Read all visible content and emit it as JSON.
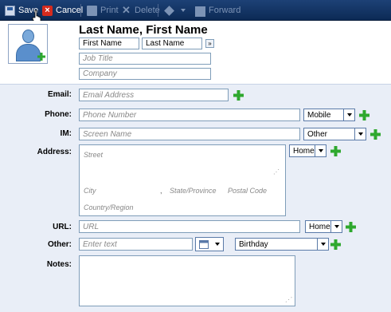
{
  "toolbar": {
    "save": "Save",
    "cancel": "Cancel",
    "print": "Print",
    "delete": "Delete",
    "forward": "Forward"
  },
  "header": {
    "display_name": "Last Name, First Name",
    "first_name": "First Name",
    "last_name": "Last Name",
    "more_name_btn": "»",
    "job_title_placeholder": "Job Title",
    "company_placeholder": "Company"
  },
  "form": {
    "email": {
      "label": "Email:",
      "placeholder": "Email Address"
    },
    "phone": {
      "label": "Phone:",
      "placeholder": "Phone Number",
      "type": "Mobile"
    },
    "im": {
      "label": "IM:",
      "placeholder": "Screen Name",
      "type": "Other"
    },
    "address": {
      "label": "Address:",
      "type": "Home",
      "street_placeholder": "Street",
      "city_placeholder": "City",
      "comma": ",",
      "state_placeholder": "State/Province",
      "postal_placeholder": "Postal Code",
      "country_placeholder": "Country/Region"
    },
    "url": {
      "label": "URL:",
      "placeholder": "URL",
      "type": "Home"
    },
    "other": {
      "label": "Other:",
      "placeholder": "Enter text",
      "type": "Birthday"
    },
    "notes": {
      "label": "Notes:"
    }
  },
  "colors": {
    "toolbar_bg": "#0c2a55",
    "form_bg": "#e9eef7",
    "plus_green": "#2ea82e"
  }
}
